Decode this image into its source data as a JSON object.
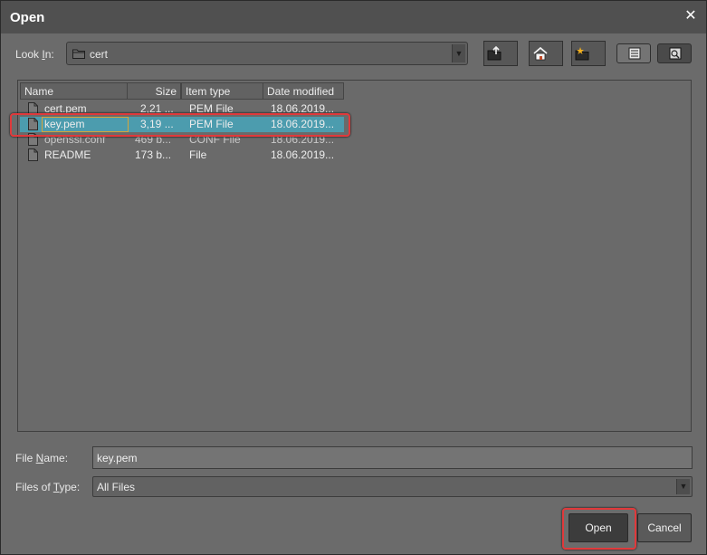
{
  "window": {
    "title": "Open",
    "close_glyph": "✕"
  },
  "look_in": {
    "label_pre": "Look ",
    "label_mnemonic": "I",
    "label_post": "n:",
    "value": "cert"
  },
  "toolbar": {
    "icons": [
      "up-one-level-icon",
      "home-icon",
      "new-folder-icon",
      "list-view-icon",
      "details-view-icon"
    ]
  },
  "file_list": {
    "columns": {
      "name": "Name",
      "size": "Size",
      "type": "Item type",
      "modified": "Date modified"
    },
    "rows": [
      {
        "name": "cert.pem",
        "size": "2,21 ...",
        "type": "PEM File",
        "modified": "18.06.2019..."
      },
      {
        "name": "key.pem",
        "size": "3,19 ...",
        "type": "PEM File",
        "modified": "18.06.2019..."
      },
      {
        "name": "openssl.conf",
        "size": "469 b...",
        "type": "CONF File",
        "modified": "18.06.2019..."
      },
      {
        "name": "README",
        "size": "173 b...",
        "type": "File",
        "modified": "18.06.2019..."
      }
    ]
  },
  "file_name": {
    "label_pre": "File ",
    "label_mnemonic": "N",
    "label_post": "ame:",
    "value": "key.pem"
  },
  "file_type": {
    "label_pre": "Files of ",
    "label_mnemonic": "T",
    "label_post": "ype:",
    "value": "All Files"
  },
  "actions": {
    "open_label": "Open",
    "cancel_label": "Cancel"
  },
  "colors": {
    "selection": "#4c9cae",
    "highlight_outline": "#e0393b",
    "dialog_background": "#6b6b6b"
  }
}
